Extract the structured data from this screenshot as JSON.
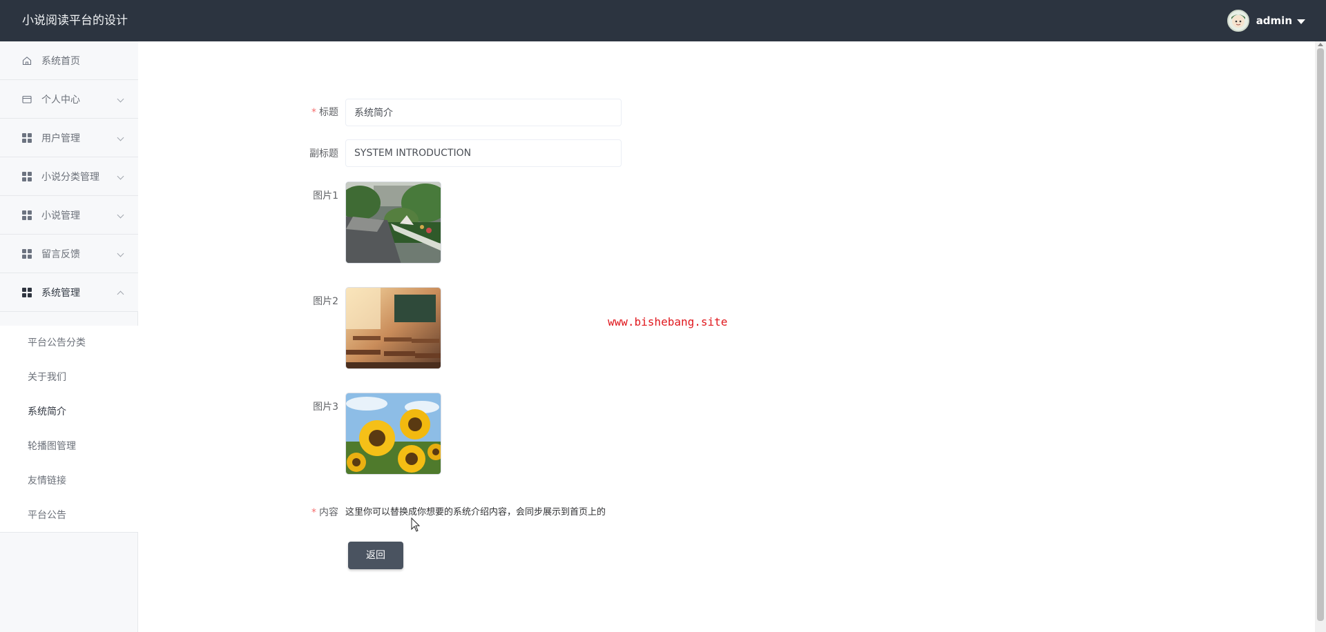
{
  "header": {
    "app_title": "小说阅读平台的设计",
    "user_name": "admin"
  },
  "sidebar": {
    "items": [
      {
        "label": "系统首页",
        "icon": "home-icon"
      },
      {
        "label": "个人中心",
        "icon": "card-icon"
      },
      {
        "label": "用户管理",
        "icon": "grid-icon"
      },
      {
        "label": "小说分类管理",
        "icon": "grid-icon"
      },
      {
        "label": "小说管理",
        "icon": "grid-icon"
      },
      {
        "label": "留言反馈",
        "icon": "grid-icon"
      },
      {
        "label": "系统管理",
        "icon": "grid-icon"
      }
    ],
    "submenu": [
      {
        "label": "平台公告分类"
      },
      {
        "label": "关于我们"
      },
      {
        "label": "系统简介"
      },
      {
        "label": "轮播图管理"
      },
      {
        "label": "友情链接"
      },
      {
        "label": "平台公告"
      }
    ]
  },
  "form": {
    "title_label": "标题",
    "title_value": "系统简介",
    "subtitle_label": "副标题",
    "subtitle_value": "SYSTEM INTRODUCTION",
    "image1_label": "图片1",
    "image2_label": "图片2",
    "image3_label": "图片3",
    "content_label": "内容",
    "content_value": "这里你可以替换成你想要的系统介绍内容，会同步展示到首页上的",
    "back_label": "返回"
  },
  "watermark": "www.bishebang.site",
  "colors": {
    "header_bg": "#2c3440",
    "sidebar_bg": "#f7f8fa",
    "button_bg": "#4a5360",
    "required": "#f56c6c",
    "watermark": "#e0171d"
  }
}
